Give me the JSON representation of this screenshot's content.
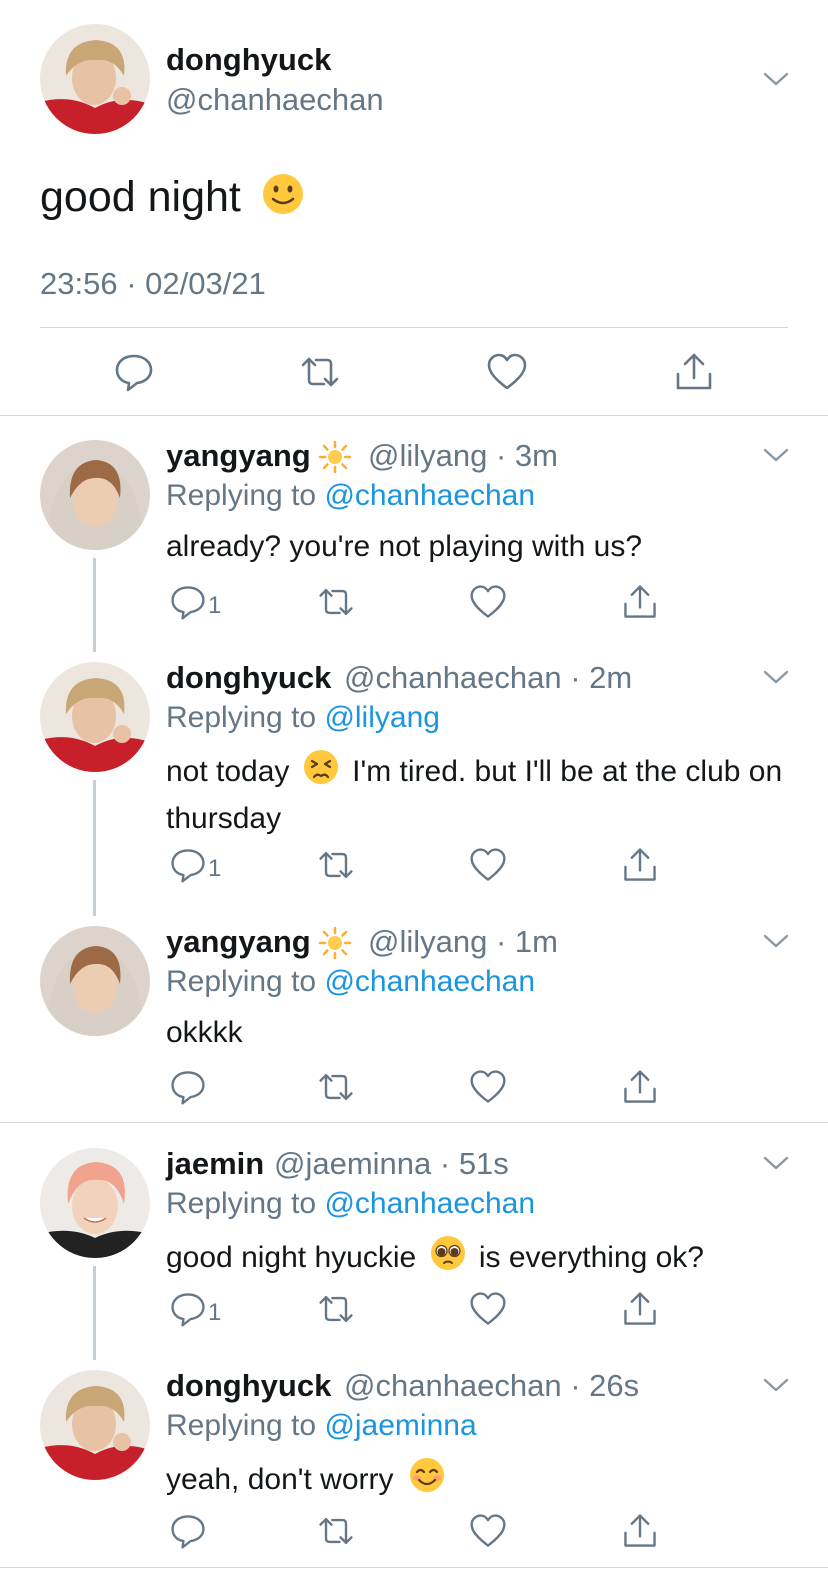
{
  "main_tweet": {
    "name": "donghyuck",
    "handle": "@chanhaechan",
    "text": "good night",
    "timestamp": "23:56 · 02/03/21",
    "emoji": "slightly-smiling-face"
  },
  "replies": [
    {
      "name": "yangyang",
      "name_emoji": "sun-icon",
      "handle_time": "@lilyang · 3m",
      "replying_prefix": "Replying to",
      "replying_to": "@chanhaechan",
      "text_before": "already? you're not playing with us?",
      "text_after": "",
      "reply_count": "1"
    },
    {
      "name": "donghyuck",
      "name_emoji": "",
      "handle_time": "@chanhaechan · 2m",
      "replying_prefix": "Replying to",
      "replying_to": "@lilyang",
      "text_before": "not today",
      "text_after": "I'm tired. but I'll be at the club on thursday",
      "text_emoji": "persevering-face",
      "reply_count": "1"
    },
    {
      "name": "yangyang",
      "name_emoji": "sun-icon",
      "handle_time": "@lilyang · 1m",
      "replying_prefix": "Replying to",
      "replying_to": "@chanhaechan",
      "text_before": "okkkk",
      "text_after": "",
      "reply_count": ""
    },
    {
      "name": "jaemin",
      "name_emoji": "",
      "handle_time": "@jaeminna · 51s",
      "replying_prefix": "Replying to",
      "replying_to": "@chanhaechan",
      "text_before": "good night hyuckie",
      "text_after": "is everything ok?",
      "text_emoji": "pleading-face",
      "reply_count": "1"
    },
    {
      "name": "donghyuck",
      "name_emoji": "",
      "handle_time": "@chanhaechan · 26s",
      "replying_prefix": "Replying to",
      "replying_to": "@jaeminna",
      "text_before": "yeah, don't worry",
      "text_after": "",
      "text_emoji": "smiling-face-with-smiling-eyes",
      "reply_count": ""
    }
  ],
  "colors": {
    "text": "#14171a",
    "secondary": "#657786",
    "link": "#1b95e0",
    "separator": "#d3d9de"
  }
}
